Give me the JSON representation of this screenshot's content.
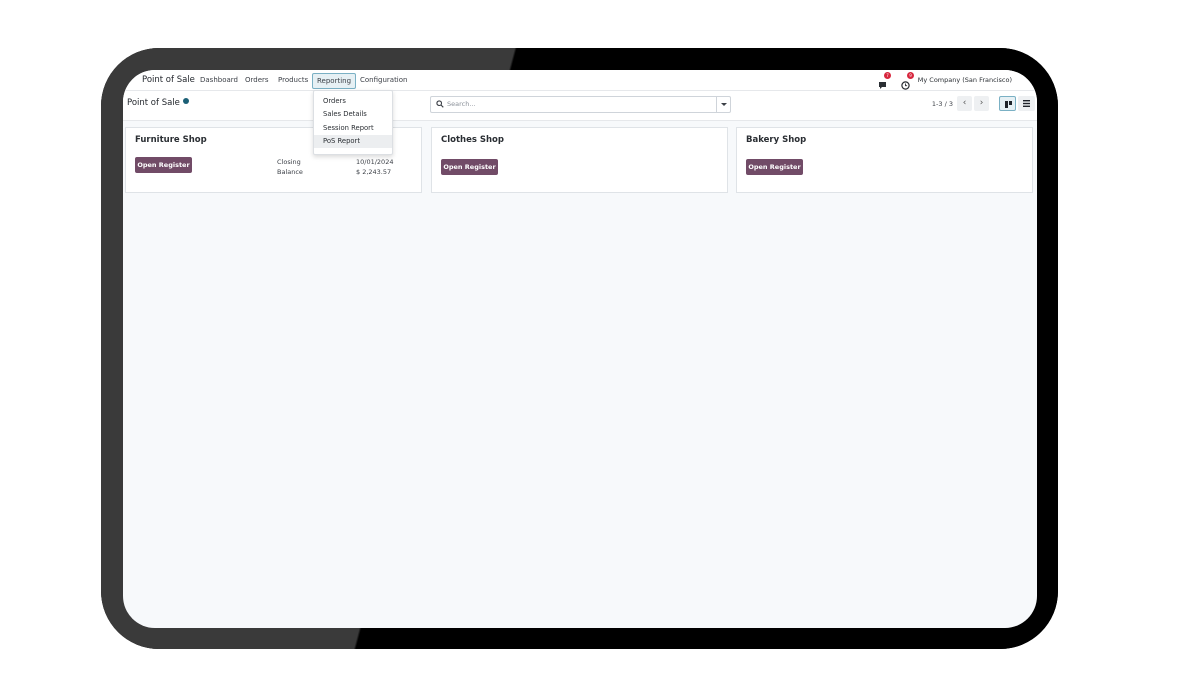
{
  "navbar": {
    "app_name": "Point of Sale",
    "menu": [
      "Dashboard",
      "Orders",
      "Products",
      "Reporting",
      "Configuration"
    ],
    "messages_count": "7",
    "activities_count": "9",
    "company": "My Company (San Francisco)"
  },
  "reporting_menu": {
    "items": [
      "Orders",
      "Sales Details",
      "Session Report",
      "PoS Report"
    ],
    "highlighted": "PoS Report"
  },
  "control_panel": {
    "breadcrumb": "Point of Sale",
    "search_placeholder": "Search...",
    "pager": "1-3 / 3",
    "prev_icon": "‹",
    "next_icon": "›"
  },
  "cards": [
    {
      "title": "Furniture Shop",
      "button": "Open Register",
      "closing_label": "Closing",
      "closing_value": "10/01/2024",
      "balance_label": "Balance",
      "balance_value": "$ 2,243.57"
    },
    {
      "title": "Clothes Shop",
      "button": "Open Register"
    },
    {
      "title": "Bakery Shop",
      "button": "Open Register"
    }
  ],
  "colors": {
    "primary": "#714b67",
    "accent": "#1b5f76",
    "badge": "#d7263d"
  }
}
